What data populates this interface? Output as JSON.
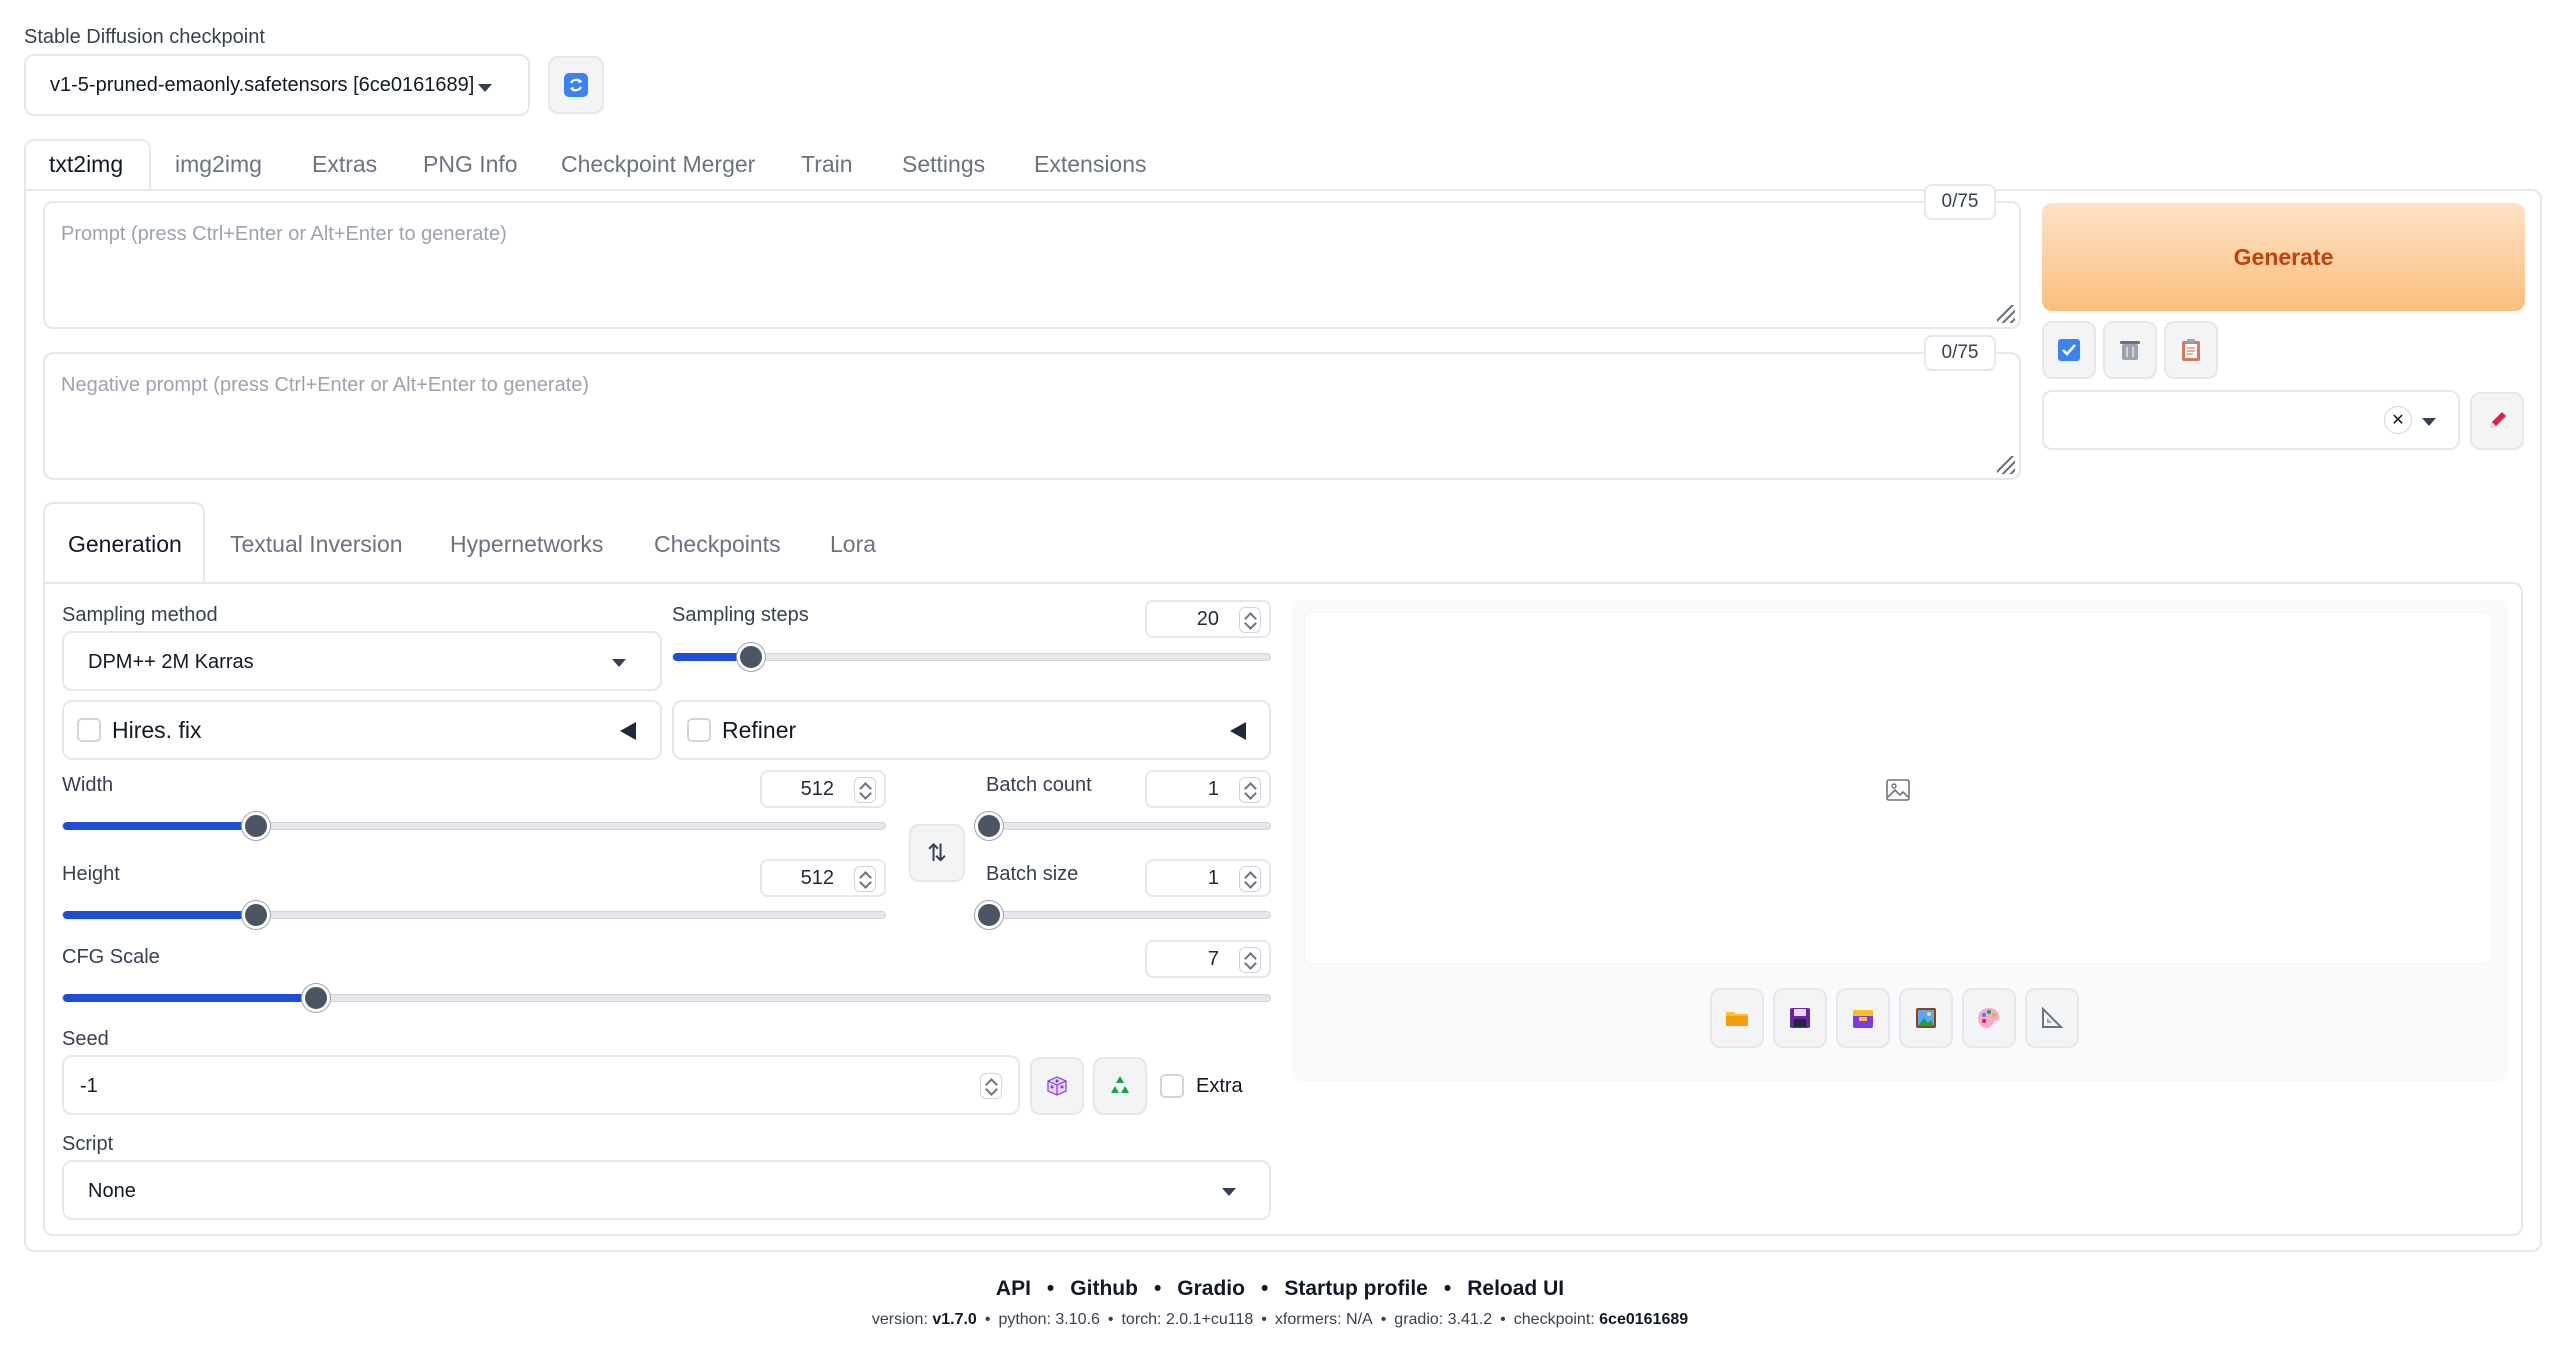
{
  "checkpoint": {
    "label": "Stable Diffusion checkpoint",
    "selected": "v1-5-pruned-emaonly.safetensors [6ce0161689]",
    "refresh_icon": "refresh-icon"
  },
  "tabs": [
    "txt2img",
    "img2img",
    "Extras",
    "PNG Info",
    "Checkpoint Merger",
    "Train",
    "Settings",
    "Extensions"
  ],
  "active_tab": "txt2img",
  "prompt": {
    "placeholder": "Prompt (press Ctrl+Enter or Alt+Enter to generate)",
    "counter": "0/75"
  },
  "negative_prompt": {
    "placeholder": "Negative prompt (press Ctrl+Enter or Alt+Enter to generate)",
    "counter": "0/75"
  },
  "generate_label": "Generate",
  "tool_buttons": [
    "apply-styles-icon",
    "trash-icon",
    "clipboard-icon"
  ],
  "styles": {
    "value": "",
    "clear_icon": "✕",
    "edit_icon": "pencil-icon"
  },
  "subtabs": [
    "Generation",
    "Textual Inversion",
    "Hypernetworks",
    "Checkpoints",
    "Lora"
  ],
  "active_subtab": "Generation",
  "sampling_method": {
    "label": "Sampling method",
    "value": "DPM++ 2M Karras"
  },
  "sampling_steps": {
    "label": "Sampling steps",
    "value": "20",
    "fraction": 0.13
  },
  "hires_fix": {
    "label": "Hires. fix",
    "checked": false
  },
  "refiner": {
    "label": "Refiner",
    "checked": false
  },
  "width": {
    "label": "Width",
    "value": "512",
    "fraction": 0.235
  },
  "height": {
    "label": "Height",
    "value": "512",
    "fraction": 0.235
  },
  "batch_count": {
    "label": "Batch count",
    "value": "1",
    "fraction": 0.0
  },
  "batch_size": {
    "label": "Batch size",
    "value": "1",
    "fraction": 0.0
  },
  "swap_icon": "⇅",
  "cfg_scale": {
    "label": "CFG Scale",
    "value": "7",
    "fraction": 0.21
  },
  "seed": {
    "label": "Seed",
    "value": "-1",
    "extra_label": "Extra"
  },
  "script": {
    "label": "Script",
    "value": "None"
  },
  "output_toolbar": [
    "folder-icon",
    "save-icon",
    "zip-icon",
    "send-to-img2img-icon",
    "send-to-inpaint-icon",
    "send-to-extras-icon"
  ],
  "footer": {
    "links": [
      "API",
      "Github",
      "Gradio",
      "Startup profile",
      "Reload UI"
    ],
    "separator": "•",
    "info": [
      {
        "key": "version:",
        "value": "v1.7.0"
      },
      {
        "key": "python:",
        "value": "3.10.6"
      },
      {
        "key": "torch:",
        "value": "2.0.1+cu118"
      },
      {
        "key": "xformers:",
        "value": "N/A"
      },
      {
        "key": "gradio:",
        "value": "3.41.2"
      },
      {
        "key": "checkpoint:",
        "value": "6ce0161689"
      }
    ]
  },
  "colors": {
    "accent": "#1d4ed8",
    "generate_gradient_start": "#fde2c6",
    "generate_gradient_end": "#fbbf7e",
    "generate_text": "#c2410c"
  }
}
